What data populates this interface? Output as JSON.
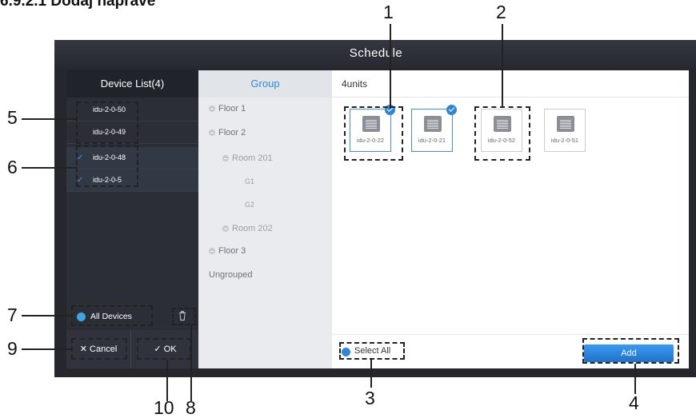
{
  "heading": "6.9.2.1 Dodaj naprave",
  "window_title": "Schedule",
  "device_panel": {
    "header": "Device List(4)",
    "devices": [
      {
        "label": "idu-2-0-50",
        "checked": false
      },
      {
        "label": "idu-2-0-49",
        "checked": false
      },
      {
        "label": "idu-2-0-48",
        "checked": true
      },
      {
        "label": "idu-2-0-5",
        "checked": true
      }
    ],
    "all_devices_label": "All Devices",
    "cancel_label": "Cancel",
    "ok_label": "OK"
  },
  "group_panel": {
    "header": "Group",
    "items": {
      "floor1": "Floor 1",
      "floor2": "Floor 2",
      "room201": "Room 201",
      "g1": "G1",
      "g2": "G2",
      "room202": "Room 202",
      "floor3": "Floor 3",
      "ungrouped": "Ungrouped"
    }
  },
  "content": {
    "header": "4units",
    "units": [
      {
        "label": "idu-2-0-22",
        "selected": true
      },
      {
        "label": "idu-2-0-21",
        "selected": true
      },
      {
        "label": "idu-2-0-52",
        "selected": false
      },
      {
        "label": "idu-2-0-51",
        "selected": false
      }
    ],
    "select_all_label": "Select All",
    "add_label": "Add"
  },
  "callouts": {
    "c1": "1",
    "c2": "2",
    "c3": "3",
    "c4": "4",
    "c5": "5",
    "c6": "6",
    "c7": "7",
    "c8": "8",
    "c9": "9",
    "c10": "10"
  },
  "colors": {
    "accent": "#2f86d6",
    "title_bar": "#2b2e35",
    "device_panel": "#2b2e35",
    "group_panel": "#e9ebee"
  }
}
